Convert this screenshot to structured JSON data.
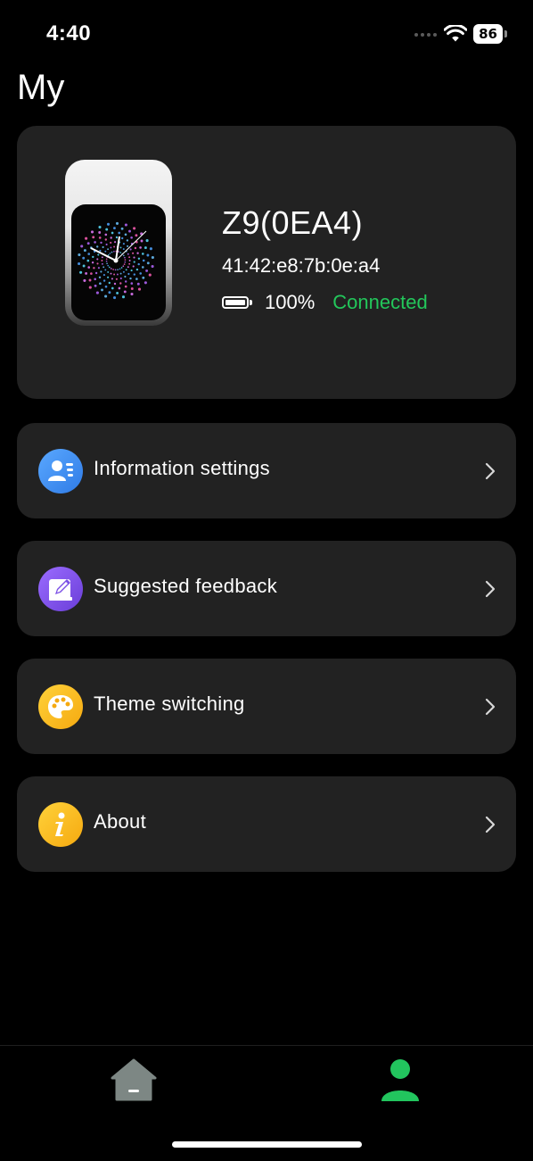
{
  "status_bar": {
    "time": "4:40",
    "battery_level": "86"
  },
  "page": {
    "title": "My"
  },
  "device": {
    "name": "Z9(0EA4)",
    "mac": "41:42:e8:7b:0e:a4",
    "battery_percent": "100%",
    "status": "Connected",
    "status_color": "#23c75b"
  },
  "menu": {
    "items": [
      {
        "label": "Information settings",
        "icon": "user-info-icon",
        "color": "#3b8ef0"
      },
      {
        "label": "Suggested feedback",
        "icon": "edit-feedback-icon",
        "color": "#7b4fe6"
      },
      {
        "label": "Theme switching",
        "icon": "palette-icon",
        "color": "#f6b81c"
      },
      {
        "label": "About",
        "icon": "info-icon",
        "color": "#f6b81c"
      }
    ]
  },
  "tab_bar": {
    "tabs": [
      {
        "icon": "home-icon",
        "active": false
      },
      {
        "icon": "profile-icon",
        "active": true
      }
    ],
    "active_color": "#22c55e",
    "inactive_color": "#7d8784"
  }
}
